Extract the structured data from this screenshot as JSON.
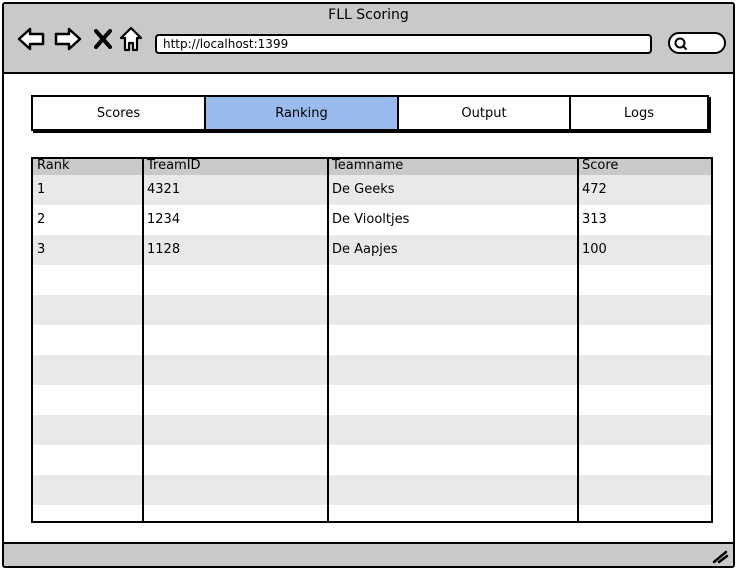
{
  "window": {
    "title": "FLL Scoring"
  },
  "nav": {
    "back_icon": "back-arrow-icon",
    "forward_icon": "forward-arrow-icon",
    "close_icon": "close-icon",
    "home_icon": "home-icon",
    "url": "http://localhost:1399",
    "search_icon": "search-icon"
  },
  "tabs": [
    {
      "label": "Scores",
      "active": false
    },
    {
      "label": "Ranking",
      "active": true
    },
    {
      "label": "Output",
      "active": false
    },
    {
      "label": "Logs",
      "active": false
    }
  ],
  "table": {
    "headers": [
      "Rank",
      "TreamID",
      "Teamname",
      "Score"
    ],
    "rows": [
      [
        "1",
        "4321",
        "De Geeks",
        "472"
      ],
      [
        "2",
        "1234",
        "De Viooltjes",
        "313"
      ],
      [
        "3",
        "1128",
        "De Aapjes",
        "100"
      ]
    ],
    "empty_rows": 9
  },
  "colors": {
    "chrome": "#c9c9c9",
    "active_tab": "#99bbee",
    "row_alt": "#e9e9e9"
  }
}
